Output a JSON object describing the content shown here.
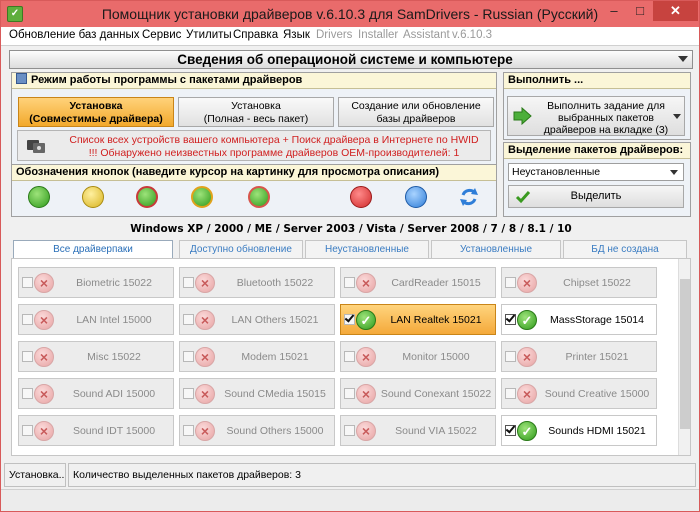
{
  "window": {
    "title": "Помощник установки драйверов v.6.10.3 для SamDrivers - Russian (Русский)"
  },
  "colors": {
    "titlebar": "#e96b6b",
    "active_button": "#f2a92c",
    "error_text": "#d02020",
    "tab_text": "#3a7cc2"
  },
  "menu": [
    {
      "label": "Обновление баз данных",
      "enabled": true
    },
    {
      "label": "Сервис",
      "enabled": true
    },
    {
      "label": "Утилиты",
      "enabled": true
    },
    {
      "label": "Справка",
      "enabled": true
    },
    {
      "label": "Язык",
      "enabled": true
    },
    {
      "label": "Drivers",
      "enabled": false
    },
    {
      "label": "Installer",
      "enabled": false
    },
    {
      "label": "Assistant",
      "enabled": false
    },
    {
      "label": "v.6.10.3",
      "enabled": false
    }
  ],
  "header": {
    "title": "Сведения об операционой системе и компьютере"
  },
  "mode_panel": {
    "title": "Режим работы программы с пакетами драйверов",
    "buttons": [
      {
        "line1": "Установка",
        "line2": "(Совместимые драйвера)",
        "active": true
      },
      {
        "line1": "Установка",
        "line2": "(Полная - весь пакет)",
        "active": false
      },
      {
        "line1": "Создание или обновление",
        "line2": "базы драйверов",
        "active": false
      }
    ],
    "info_line1": "Список всех устройств вашего компьютера + Поиск драйвера в Интернете по HWID",
    "info_line2": "!!! Обнаружено неизвестных программе драйверов OEM-производителей: 1"
  },
  "legend_panel": {
    "title": "Обозначения кнопок (наведите курсор на картинку для просмотра описания)",
    "icons": [
      "green-check-icon",
      "yellow-check-icon",
      "red-check-icon",
      "warning-check-icon",
      "outdated-check-icon",
      "not-installed-icon",
      "help-icon",
      "refresh-icon"
    ]
  },
  "execute_panel": {
    "title": "Выполнить ...",
    "button_label": "Выполнить задание для выбранных пакетов драйверов на вкладке (3)"
  },
  "selection_panel": {
    "title": "Выделение пакетов драйверов:",
    "dropdown_value": "Неустановленные",
    "button_label": "Выделить"
  },
  "os_line": "Windows XP / 2000 / ME / Server 2003 / Vista / Server 2008 / 7 / 8 / 8.1 / 10",
  "tabs": [
    {
      "label": "Все драйверпаки",
      "active": true
    },
    {
      "label": "Доступно обновление",
      "active": false
    },
    {
      "label": "Неустановленные",
      "active": false
    },
    {
      "label": "Установленные",
      "active": false
    },
    {
      "label": "БД не создана",
      "active": false
    }
  ],
  "drivers": [
    {
      "name": "Biometric 15022",
      "status": "x",
      "checked": false,
      "state": "normal"
    },
    {
      "name": "Bluetooth 15022",
      "status": "x",
      "checked": false,
      "state": "normal"
    },
    {
      "name": "CardReader 15015",
      "status": "x",
      "checked": false,
      "state": "normal"
    },
    {
      "name": "Chipset 15022",
      "status": "x",
      "checked": false,
      "state": "normal"
    },
    {
      "name": "LAN Intel 15000",
      "status": "x",
      "checked": false,
      "state": "normal"
    },
    {
      "name": "LAN Others 15021",
      "status": "x",
      "checked": false,
      "state": "normal"
    },
    {
      "name": "LAN Realtek 15021",
      "status": "ok",
      "checked": true,
      "state": "orange"
    },
    {
      "name": "MassStorage 15014",
      "status": "ok",
      "checked": true,
      "state": "selected"
    },
    {
      "name": "Misc 15022",
      "status": "x",
      "checked": false,
      "state": "normal"
    },
    {
      "name": "Modem 15021",
      "status": "x",
      "checked": false,
      "state": "normal"
    },
    {
      "name": "Monitor 15000",
      "status": "x",
      "checked": false,
      "state": "normal"
    },
    {
      "name": "Printer 15021",
      "status": "x",
      "checked": false,
      "state": "normal"
    },
    {
      "name": "Sound ADI 15000",
      "status": "x",
      "checked": false,
      "state": "normal"
    },
    {
      "name": "Sound CMedia 15015",
      "status": "x",
      "checked": false,
      "state": "normal"
    },
    {
      "name": "Sound Conexant 15022",
      "status": "x",
      "checked": false,
      "state": "normal"
    },
    {
      "name": "Sound Creative 15000",
      "status": "x",
      "checked": false,
      "state": "normal"
    },
    {
      "name": "Sound IDT 15000",
      "status": "x",
      "checked": false,
      "state": "normal"
    },
    {
      "name": "Sound Others 15000",
      "status": "x",
      "checked": false,
      "state": "normal"
    },
    {
      "name": "Sound VIA 15022",
      "status": "x",
      "checked": false,
      "state": "normal"
    },
    {
      "name": "Sounds HDMI 15021",
      "status": "ok",
      "checked": true,
      "state": "selected"
    }
  ],
  "status_bar": {
    "left": "Установка...",
    "right": "Количество выделенных пакетов драйверов: 3"
  }
}
